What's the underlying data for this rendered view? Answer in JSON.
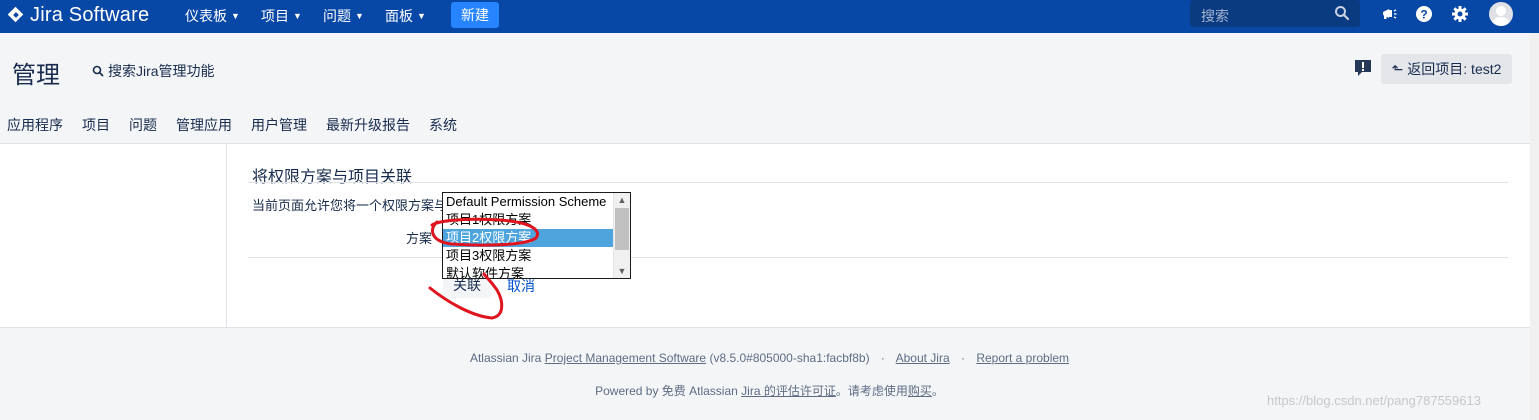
{
  "topnav": {
    "logo_text": "Jira Software",
    "items": [
      {
        "label": "仪表板"
      },
      {
        "label": "项目"
      },
      {
        "label": "问题"
      },
      {
        "label": "面板"
      }
    ],
    "create_label": "新建",
    "search_placeholder": "搜索",
    "icons": [
      "notifications-icon",
      "help-icon",
      "settings-icon",
      "avatar"
    ]
  },
  "admin": {
    "title": "管理",
    "search_label": "搜索Jira管理功能",
    "back_label": "返回项目: test2",
    "tabs": [
      "应用程序",
      "项目",
      "问题",
      "管理应用",
      "用户管理",
      "最新升级报告",
      "系统"
    ]
  },
  "form": {
    "title": "将权限方案与项目关联",
    "description": "当前页面允许您将一个权限方案与",
    "field_label": "方案",
    "options": [
      {
        "label": "Default Permission Scheme",
        "selected": false
      },
      {
        "label": "项目1权限方案",
        "selected": false
      },
      {
        "label": "项目2权限方案",
        "selected": true
      },
      {
        "label": "项目3权限方案",
        "selected": false
      },
      {
        "label": "默认软件方案",
        "selected": false
      }
    ],
    "associate_label": "关联",
    "cancel_label": "取消"
  },
  "footer": {
    "line1_prefix": "Atlassian Jira",
    "line1_link": "Project Management Software",
    "line1_version": "(v8.5.0#805000-sha1:facbf8b)",
    "about_link": "About Jira",
    "report_link": "Report a problem",
    "line2_prefix": "Powered by 免费 Atlassian",
    "line2_link": "Jira 的评估许可证",
    "line2_mid": "。请考虑使用",
    "line2_buy": "购买",
    "line2_suffix": "。"
  },
  "watermark": "https://blog.csdn.net/pang787559613",
  "colors": {
    "topbar": "#0747a6",
    "create_button": "#2684ff",
    "selected_option": "#4ea5dd",
    "annotation": "#e0141e",
    "link": "#0052cc"
  }
}
